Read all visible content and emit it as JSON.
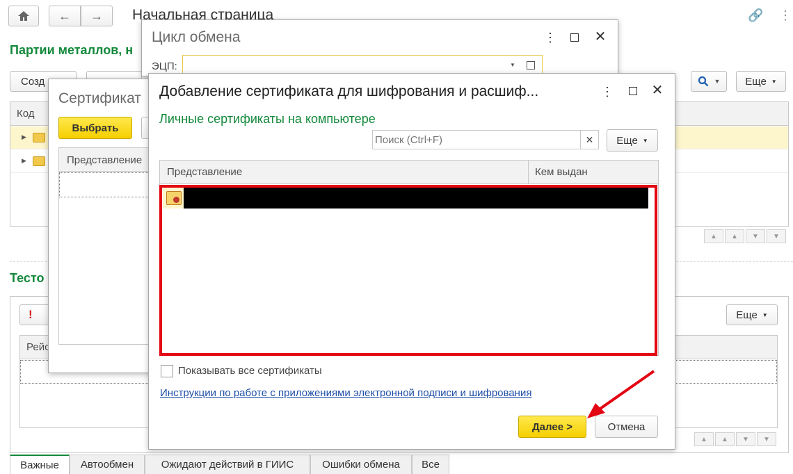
{
  "main": {
    "page_title": "Начальная страница",
    "section1_title": "Партии металлов, н",
    "create_label": "Созд",
    "more_label": "Еще",
    "col_code": "Код",
    "section2_title": "Тесто",
    "more2_label": "Еще",
    "col_reis": "Рейс"
  },
  "tabs": [
    "Важные",
    "Автообмен",
    "Ожидают действий в ГИИС",
    "Ошибки обмена",
    "Все"
  ],
  "cycle_window": {
    "title": "Цикл обмена",
    "ecp_label": "ЭЦП:"
  },
  "cert_window": {
    "title": "Сертификат",
    "select_label": "Выбрать",
    "col_repr": "Представление"
  },
  "dialog": {
    "title": "Добавление сертификата для шифрования и расшиф...",
    "section_title": "Личные сертификаты на компьютере",
    "search_placeholder": "Поиск (Ctrl+F)",
    "more_label": "Еще",
    "col_repr": "Представление",
    "col_issuer": "Кем выдан",
    "show_all_label": "Показывать все сертификаты",
    "instructions_link": "Инструкции по работе с приложениями электронной подписи и шифрования",
    "next_label": "Далее >",
    "cancel_label": "Отмена"
  },
  "colors": {
    "accent_green": "#13893b",
    "highlight_red": "#e30613",
    "button_yellow": "#f5cf00",
    "link_blue": "#1f4fa8"
  }
}
